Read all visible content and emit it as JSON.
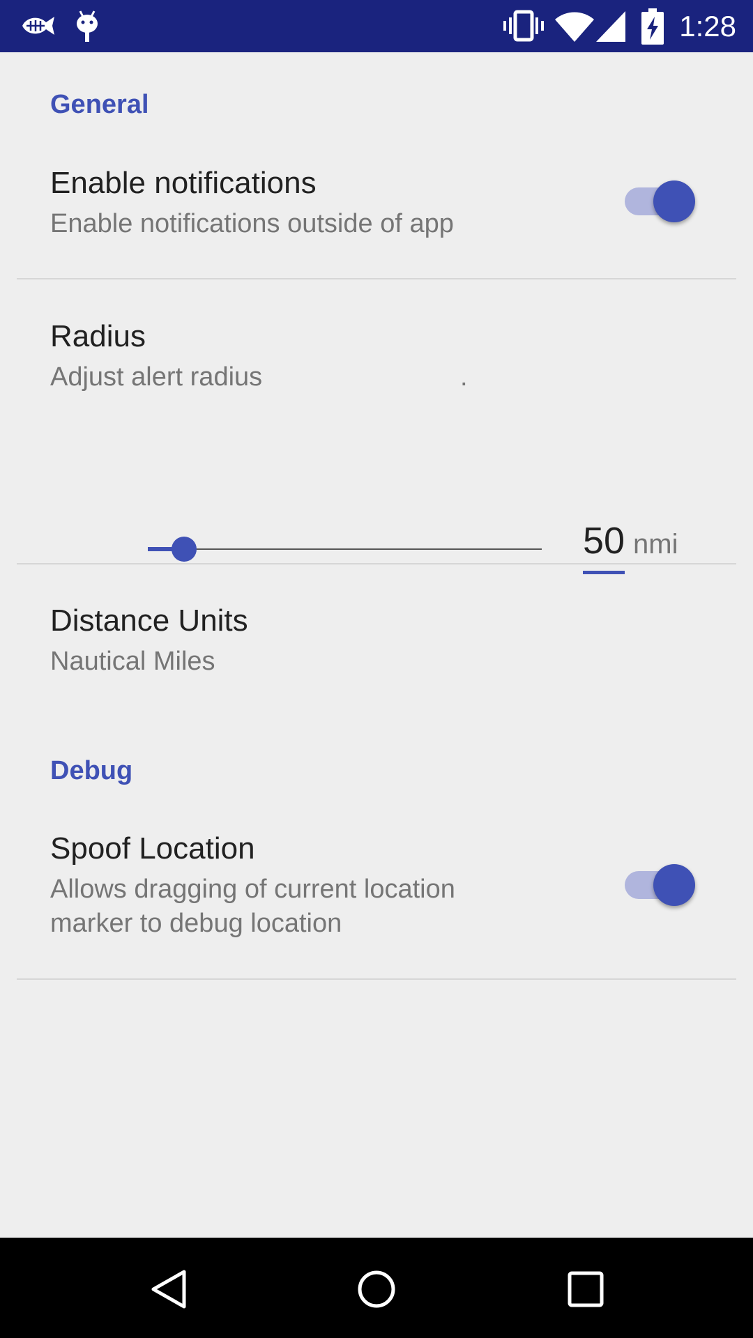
{
  "status_bar": {
    "time": "1:28",
    "left_icons": [
      "fish-icon",
      "android-icon"
    ],
    "right_icons": [
      "vibrate-icon",
      "wifi-icon",
      "cell-signal-icon",
      "battery-charging-icon"
    ],
    "background": "#1a237e"
  },
  "colors": {
    "accent": "#3f51b5",
    "category_text": "#3f51b5",
    "background": "#eeeeee"
  },
  "preferences": {
    "general": {
      "category_label": "General",
      "enable_notifications": {
        "title": "Enable notifications",
        "summary": "Enable notifications outside of app",
        "checked": true
      },
      "radius": {
        "title": "Radius",
        "summary": "Adjust alert radius",
        "trailing_mark": ".",
        "value": "50",
        "unit": "nmi",
        "slider_fraction": 0.07
      },
      "distance_units": {
        "title": "Distance Units",
        "summary": "Nautical Miles"
      }
    },
    "debug": {
      "category_label": "Debug",
      "spoof_location": {
        "title": "Spoof Location",
        "summary_line1": "Allows dragging of current location",
        "summary_line2": "marker to debug location",
        "checked": true
      }
    }
  },
  "nav_bar": {
    "buttons": [
      "back-icon",
      "home-icon",
      "recents-icon"
    ]
  }
}
